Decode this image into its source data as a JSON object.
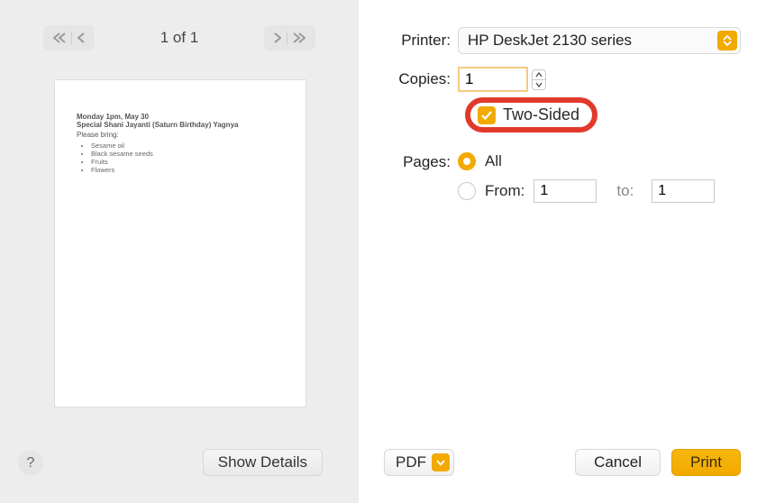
{
  "preview": {
    "page_indicator": "1 of 1",
    "document": {
      "line1": "Monday 1pm, May 30",
      "line2": "Special Shani Jayanti (Saturn Birthday) Yagnya",
      "bring_label": "Please bring:",
      "items": [
        "Sesame oil",
        "Black sesame seeds",
        "Fruits",
        "Flowers"
      ]
    },
    "show_details_label": "Show Details",
    "help_label": "?"
  },
  "settings": {
    "printer": {
      "label": "Printer:",
      "value": "HP DeskJet 2130 series"
    },
    "copies": {
      "label": "Copies:",
      "value": "1",
      "two_sided_label": "Two-Sided",
      "two_sided_checked": true
    },
    "pages": {
      "label": "Pages:",
      "all_label": "All",
      "from_label": "From:",
      "to_label": "to:",
      "from_value": "1",
      "to_value": "1",
      "selected": "all"
    }
  },
  "bottom": {
    "pdf_label": "PDF",
    "cancel_label": "Cancel",
    "print_label": "Print"
  }
}
